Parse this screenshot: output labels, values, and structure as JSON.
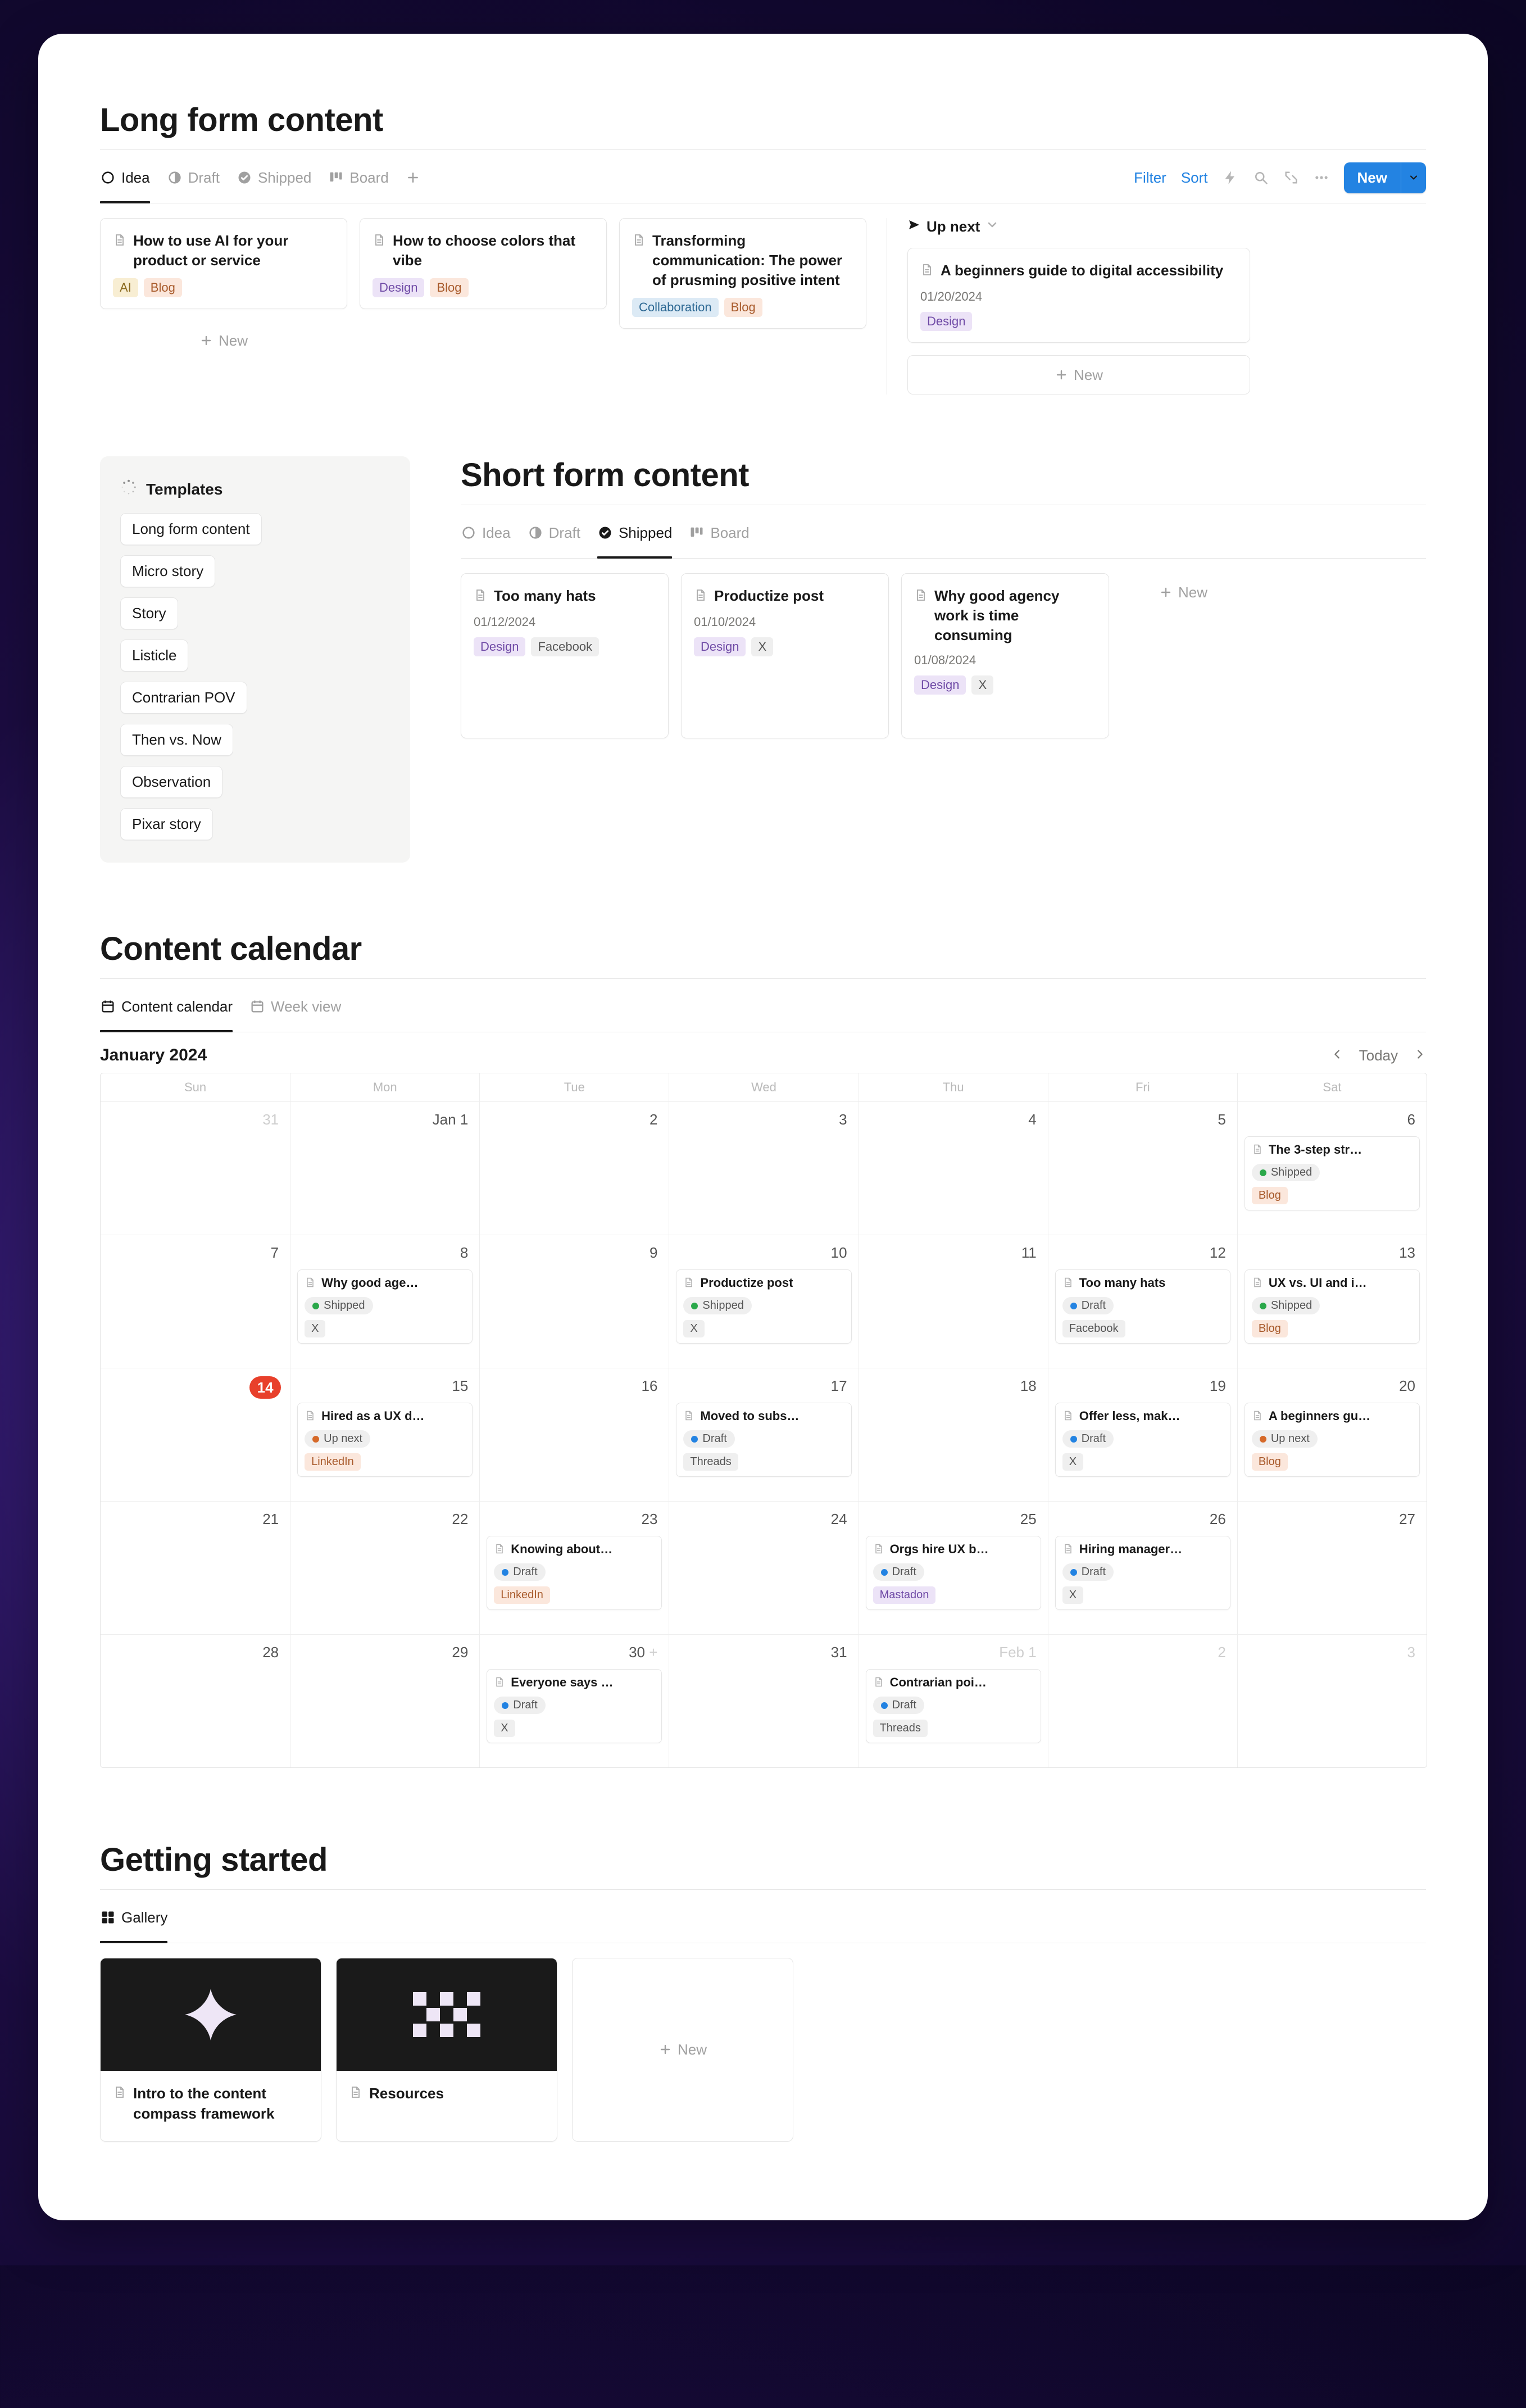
{
  "sections": {
    "longform": {
      "title": "Long form content",
      "tabs": [
        "Idea",
        "Draft",
        "Shipped",
        "Board"
      ],
      "active_tab": "Idea",
      "tools": {
        "filter": "Filter",
        "sort": "Sort",
        "new": "New"
      },
      "up_next": "Up next",
      "cards": [
        {
          "title": "How to use AI for your product or service",
          "tags": [
            {
              "t": "AI",
              "c": "yellow"
            },
            {
              "t": "Blog",
              "c": "orange"
            }
          ]
        },
        {
          "title": "How to choose colors that vibe",
          "tags": [
            {
              "t": "Design",
              "c": "purple"
            },
            {
              "t": "Blog",
              "c": "orange"
            }
          ]
        },
        {
          "title": "Transforming communication: The power of prusming positive intent",
          "tags": [
            {
              "t": "Collaboration",
              "c": "blue"
            },
            {
              "t": "Blog",
              "c": "orange"
            }
          ]
        }
      ],
      "up_next_card": {
        "title": "A beginners guide to digital accessibility",
        "date": "01/20/2024",
        "tags": [
          {
            "t": "Design",
            "c": "purple"
          }
        ]
      },
      "new_label": "New"
    },
    "templates": {
      "heading": "Templates",
      "items": [
        "Long form content",
        "Micro story",
        "Story",
        "Listicle",
        "Contrarian POV",
        "Then vs. Now",
        "Observation",
        "Pixar story"
      ]
    },
    "shortform": {
      "title": "Short form content",
      "tabs": [
        "Idea",
        "Draft",
        "Shipped",
        "Board"
      ],
      "active_tab": "Shipped",
      "cards": [
        {
          "title": "Too many hats",
          "date": "01/12/2024",
          "tags": [
            {
              "t": "Design",
              "c": "purple"
            },
            {
              "t": "Facebook",
              "c": "grey"
            }
          ]
        },
        {
          "title": "Productize post",
          "date": "01/10/2024",
          "tags": [
            {
              "t": "Design",
              "c": "purple"
            },
            {
              "t": "X",
              "c": "grey"
            }
          ]
        },
        {
          "title": "Why good agency work is time consuming",
          "date": "01/08/2024",
          "tags": [
            {
              "t": "Design",
              "c": "purple"
            },
            {
              "t": "X",
              "c": "grey"
            }
          ]
        }
      ],
      "new_label": "New"
    },
    "calendar": {
      "title": "Content calendar",
      "tabs": [
        "Content calendar",
        "Week view"
      ],
      "active_tab": "Content calendar",
      "month": "January 2024",
      "today": "Today",
      "dow": [
        "Sun",
        "Mon",
        "Tue",
        "Wed",
        "Thu",
        "Fri",
        "Sat"
      ],
      "weeks": [
        [
          {
            "n": "31",
            "muted": true
          },
          {
            "n": "Jan 1"
          },
          {
            "n": "2"
          },
          {
            "n": "3"
          },
          {
            "n": "4"
          },
          {
            "n": "5"
          },
          {
            "n": "6",
            "events": [
              {
                "title": "The 3-step str…",
                "status": {
                  "t": "Shipped",
                  "c": "green"
                },
                "tag": {
                  "t": "Blog",
                  "c": "orange"
                }
              }
            ]
          }
        ],
        [
          {
            "n": "7"
          },
          {
            "n": "8",
            "events": [
              {
                "title": "Why good age…",
                "status": {
                  "t": "Shipped",
                  "c": "green"
                },
                "tag": {
                  "t": "X",
                  "c": "grey"
                }
              }
            ]
          },
          {
            "n": "9"
          },
          {
            "n": "10",
            "events": [
              {
                "title": "Productize post",
                "status": {
                  "t": "Shipped",
                  "c": "green"
                },
                "tag": {
                  "t": "X",
                  "c": "grey"
                }
              }
            ]
          },
          {
            "n": "11"
          },
          {
            "n": "12",
            "events": [
              {
                "title": "Too many hats",
                "status": {
                  "t": "Draft",
                  "c": "blue"
                },
                "tag": {
                  "t": "Facebook",
                  "c": "grey"
                }
              }
            ]
          },
          {
            "n": "13",
            "events": [
              {
                "title": "UX vs. UI and i…",
                "status": {
                  "t": "Shipped",
                  "c": "green"
                },
                "tag": {
                  "t": "Blog",
                  "c": "orange"
                }
              }
            ]
          }
        ],
        [
          {
            "n": "14",
            "today": true
          },
          {
            "n": "15",
            "events": [
              {
                "title": "Hired as a UX d…",
                "status": {
                  "t": "Up next",
                  "c": "orange"
                },
                "tag": {
                  "t": "LinkedIn",
                  "c": "orange"
                }
              }
            ]
          },
          {
            "n": "16"
          },
          {
            "n": "17",
            "events": [
              {
                "title": "Moved to subs…",
                "status": {
                  "t": "Draft",
                  "c": "blue"
                },
                "tag": {
                  "t": "Threads",
                  "c": "grey"
                }
              }
            ]
          },
          {
            "n": "18"
          },
          {
            "n": "19",
            "events": [
              {
                "title": "Offer less, mak…",
                "status": {
                  "t": "Draft",
                  "c": "blue"
                },
                "tag": {
                  "t": "X",
                  "c": "grey"
                }
              }
            ]
          },
          {
            "n": "20",
            "events": [
              {
                "title": "A beginners gu…",
                "status": {
                  "t": "Up next",
                  "c": "orange"
                },
                "tag": {
                  "t": "Blog",
                  "c": "orange"
                }
              }
            ]
          }
        ],
        [
          {
            "n": "21"
          },
          {
            "n": "22"
          },
          {
            "n": "23",
            "events": [
              {
                "title": "Knowing about…",
                "status": {
                  "t": "Draft",
                  "c": "blue"
                },
                "tag": {
                  "t": "LinkedIn",
                  "c": "orange"
                }
              }
            ]
          },
          {
            "n": "24"
          },
          {
            "n": "25",
            "events": [
              {
                "title": "Orgs hire UX b…",
                "status": {
                  "t": "Draft",
                  "c": "blue"
                },
                "tag": {
                  "t": "Mastadon",
                  "c": "purple"
                }
              }
            ]
          },
          {
            "n": "26",
            "events": [
              {
                "title": "Hiring manager…",
                "status": {
                  "t": "Draft",
                  "c": "blue"
                },
                "tag": {
                  "t": "X",
                  "c": "grey"
                }
              }
            ]
          },
          {
            "n": "27"
          }
        ],
        [
          {
            "n": "28"
          },
          {
            "n": "29"
          },
          {
            "n": "30",
            "plus": true,
            "events": [
              {
                "title": "Everyone says …",
                "status": {
                  "t": "Draft",
                  "c": "blue"
                },
                "tag": {
                  "t": "X",
                  "c": "grey"
                }
              }
            ]
          },
          {
            "n": "31"
          },
          {
            "n": "Feb 1",
            "muted": true,
            "events": [
              {
                "title": "Contrarian poi…",
                "status": {
                  "t": "Draft",
                  "c": "blue"
                },
                "tag": {
                  "t": "Threads",
                  "c": "grey"
                }
              }
            ]
          },
          {
            "n": "2",
            "muted": true
          },
          {
            "n": "3",
            "muted": true
          }
        ]
      ]
    },
    "getting_started": {
      "title": "Getting started",
      "tab": "Gallery",
      "cards": [
        {
          "kind": "sparkle",
          "title": "Intro to the content compass framework"
        },
        {
          "kind": "checker",
          "title": "Resources"
        }
      ],
      "new_label": "New"
    }
  }
}
